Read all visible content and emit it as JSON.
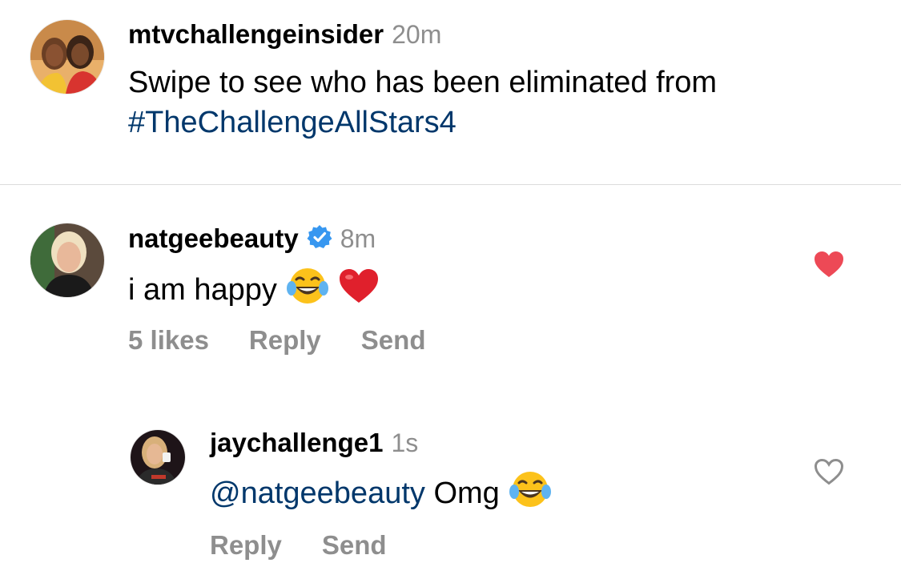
{
  "caption": {
    "username": "mtvchallengeinsider",
    "time": "20m",
    "text": "Swipe to see who has been eliminated from",
    "hashtag": "#TheChallengeAllStars4"
  },
  "comment": {
    "username": "natgeebeauty",
    "verified": true,
    "time": "8m",
    "text": "i am happy",
    "emojis": [
      "face-with-tears-of-joy",
      "red-heart"
    ],
    "likes_label": "5 likes",
    "reply_label": "Reply",
    "send_label": "Send",
    "liked": true
  },
  "reply": {
    "username": "jaychallenge1",
    "time": "1s",
    "mention": "@natgeebeauty",
    "text": "Omg",
    "emojis": [
      "face-with-tears-of-joy"
    ],
    "reply_label": "Reply",
    "send_label": "Send",
    "liked": false
  },
  "colors": {
    "like_active": "#ed4956",
    "link": "#00376b",
    "muted": "#8e8e8e",
    "verified": "#3797f0"
  }
}
